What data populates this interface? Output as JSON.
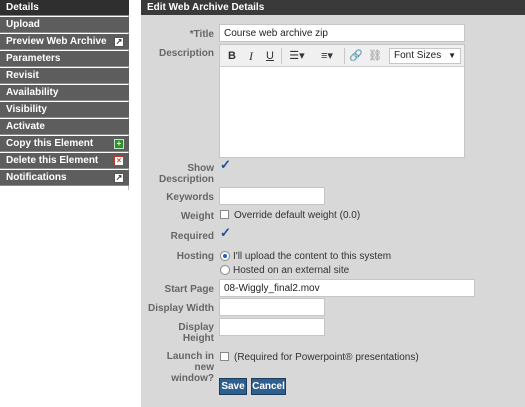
{
  "sidebar": {
    "items": [
      {
        "label": "Details",
        "active": true
      },
      {
        "label": "Upload"
      },
      {
        "label": "Preview Web Archive",
        "icon": "external-link-icon"
      },
      {
        "label": "Parameters"
      },
      {
        "label": "Revisit"
      },
      {
        "label": "Availability"
      },
      {
        "label": "Visibility"
      },
      {
        "label": "Activate"
      },
      {
        "label": "Copy this Element",
        "icon": "add-icon"
      },
      {
        "label": "Delete this Element",
        "icon": "delete-icon"
      },
      {
        "label": "Notifications",
        "icon": "external-link-icon"
      }
    ]
  },
  "panel": {
    "title": "Edit Web Archive Details",
    "fields": {
      "title_label": "*Title",
      "title_value": "Course web archive zip",
      "description_label": "Description",
      "font_sizes": "Font Sizes",
      "show_description_label": "Show Description",
      "keywords_label": "Keywords",
      "keywords_value": "",
      "weight_label": "Weight",
      "weight_option": "Override default weight (0.0)",
      "required_label": "Required",
      "hosting_label": "Hosting",
      "hosting_option_1": "I'll upload the content to this system",
      "hosting_option_2": "Hosted on an external site",
      "start_page_label": "Start Page",
      "start_page_value": "08-Wiggly_final2.mov",
      "display_width_label": "Display Width",
      "display_width_value": "",
      "display_height_label": "Display Height",
      "display_height_value": "",
      "launch_label": "Launch in new window?",
      "launch_option": "(Required for Powerpoint® presentations)"
    },
    "save_label": "Save",
    "cancel_label": "Cancel"
  },
  "colors": {
    "sidebar_bg": "#5d5d5d",
    "sidebar_active": "#2f2f2f",
    "panel_bg": "#d8d8d8",
    "header_bg": "#3a3a3a",
    "button_bg": "#2f5f8f",
    "check_blue": "#1f4f9f"
  }
}
